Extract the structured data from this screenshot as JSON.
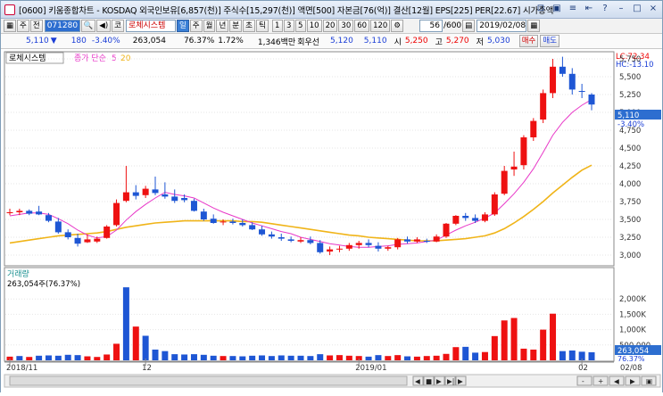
{
  "window": {
    "title": "[0600] 키움종합차트 - KOSDAQ 외국인보유[6,857(천)] 주식수[15,297(천)] 액면[500] 자본금[76(억)] 결산[12월] EPS[225] PER[22.67] 시가총액[",
    "controls": [
      "⊡",
      "▣",
      "≡",
      "⇤",
      "?",
      "–",
      "□",
      "×"
    ]
  },
  "toolbar": {
    "period_label": "주",
    "prev_label": "전",
    "code": "071280",
    "sound_label": "◀)",
    "market_label": "코",
    "stock_name": "로체시스템",
    "period_buttons": [
      "일",
      "주",
      "월",
      "년",
      "분",
      "초",
      "틱"
    ],
    "interval_buttons": [
      "1",
      "3",
      "5",
      "10",
      "20",
      "30",
      "60",
      "120"
    ],
    "count": "56",
    "count_total": "/600",
    "date": "2019/02/08"
  },
  "quote": {
    "price": "5,110",
    "arrow": "▼",
    "change": "180",
    "change_pct": "-3.40%",
    "volume": "263,054",
    "vol_ratio": "76.37%",
    "turnover": "1.72%",
    "amount": "1,346백만",
    "preferred": "회우선",
    "prev_val": "5,120",
    "cur_val": "5,110",
    "open_label": "시",
    "open": "5,250",
    "high_label": "고",
    "high": "5,270",
    "low_label": "저",
    "low": "5,030",
    "buy_label": "매수",
    "sell_label": "매도"
  },
  "chart_data": {
    "type": "candlestick",
    "legend_name": "로체시스템",
    "legend_ma_label": "종가 단순",
    "legend_ma_short": "5",
    "legend_ma_long": "20",
    "colors": {
      "up": "#ee1111",
      "down": "#1e56d4",
      "ma5": "#e838c8",
      "ma20": "#f0b418"
    },
    "ylim": [
      2900,
      5800
    ],
    "y_ticks": [
      "5,750",
      "5,500",
      "5,250",
      "5,000",
      "4,750",
      "4,500",
      "4,250",
      "4,000",
      "3,750",
      "3,500",
      "3,250",
      "3,000"
    ],
    "lc_label": "LC:72.34",
    "hc_label": "HC:-13.10",
    "last_price_label": "5,110",
    "last_change_label": "-3.40%",
    "candles": [
      [
        3600,
        3650,
        3560,
        3600
      ],
      [
        3600,
        3650,
        3560,
        3620
      ],
      [
        3620,
        3640,
        3560,
        3580
      ],
      [
        3610,
        3690,
        3560,
        3570
      ],
      [
        3560,
        3590,
        3460,
        3480
      ],
      [
        3470,
        3520,
        3300,
        3320
      ],
      [
        3320,
        3360,
        3220,
        3250
      ],
      [
        3240,
        3300,
        3120,
        3160
      ],
      [
        3180,
        3290,
        3170,
        3220
      ],
      [
        3190,
        3260,
        3170,
        3230
      ],
      [
        3240,
        3420,
        3230,
        3400
      ],
      [
        3420,
        3780,
        3400,
        3730
      ],
      [
        3760,
        4250,
        3740,
        3880
      ],
      [
        3880,
        3980,
        3780,
        3830
      ],
      [
        3840,
        3970,
        3800,
        3930
      ],
      [
        3920,
        4100,
        3840,
        3870
      ],
      [
        3850,
        4020,
        3790,
        3820
      ],
      [
        3820,
        3920,
        3730,
        3760
      ],
      [
        3800,
        3850,
        3740,
        3770
      ],
      [
        3760,
        3790,
        3610,
        3620
      ],
      [
        3610,
        3650,
        3480,
        3500
      ],
      [
        3510,
        3570,
        3440,
        3450
      ],
      [
        3460,
        3500,
        3420,
        3470
      ],
      [
        3470,
        3510,
        3430,
        3450
      ],
      [
        3450,
        3500,
        3400,
        3420
      ],
      [
        3420,
        3460,
        3350,
        3360
      ],
      [
        3360,
        3410,
        3270,
        3290
      ],
      [
        3290,
        3330,
        3230,
        3260
      ],
      [
        3250,
        3300,
        3200,
        3230
      ],
      [
        3220,
        3260,
        3180,
        3200
      ],
      [
        3190,
        3250,
        3170,
        3210
      ],
      [
        3210,
        3260,
        3150,
        3170
      ],
      [
        3170,
        3210,
        3020,
        3040
      ],
      [
        3050,
        3120,
        3000,
        3080
      ],
      [
        3080,
        3130,
        3040,
        3090
      ],
      [
        3090,
        3170,
        3060,
        3140
      ],
      [
        3140,
        3200,
        3090,
        3170
      ],
      [
        3170,
        3220,
        3110,
        3140
      ],
      [
        3130,
        3180,
        3050,
        3090
      ],
      [
        3090,
        3130,
        3060,
        3110
      ],
      [
        3110,
        3240,
        3080,
        3220
      ],
      [
        3220,
        3260,
        3160,
        3190
      ],
      [
        3190,
        3250,
        3170,
        3220
      ],
      [
        3200,
        3230,
        3170,
        3190
      ],
      [
        3190,
        3290,
        3180,
        3260
      ],
      [
        3260,
        3450,
        3240,
        3440
      ],
      [
        3440,
        3560,
        3420,
        3550
      ],
      [
        3550,
        3590,
        3480,
        3520
      ],
      [
        3520,
        3570,
        3450,
        3480
      ],
      [
        3480,
        3600,
        3460,
        3570
      ],
      [
        3570,
        3880,
        3550,
        3850
      ],
      [
        3860,
        4250,
        3840,
        4180
      ],
      [
        4200,
        4450,
        4110,
        4240
      ],
      [
        4260,
        4680,
        4200,
        4650
      ],
      [
        4650,
        4920,
        4600,
        4880
      ],
      [
        4900,
        5320,
        4850,
        5270
      ],
      [
        5270,
        5750,
        5200,
        5640
      ],
      [
        5640,
        5780,
        5500,
        5540
      ],
      [
        5540,
        5620,
        5250,
        5320
      ],
      [
        5300,
        5400,
        5200,
        5290
      ],
      [
        5250,
        5270,
        5030,
        5110
      ]
    ],
    "ma5": [
      3550,
      3570,
      3590,
      3590,
      3570,
      3510,
      3440,
      3350,
      3280,
      3240,
      3260,
      3350,
      3490,
      3610,
      3710,
      3800,
      3880,
      3850,
      3830,
      3800,
      3730,
      3660,
      3600,
      3550,
      3500,
      3450,
      3410,
      3370,
      3330,
      3300,
      3250,
      3220,
      3190,
      3160,
      3140,
      3120,
      3110,
      3110,
      3120,
      3130,
      3150,
      3160,
      3170,
      3190,
      3210,
      3280,
      3350,
      3410,
      3460,
      3520,
      3590,
      3720,
      3860,
      4020,
      4210,
      4440,
      4680,
      4860,
      5000,
      5100,
      5180
    ],
    "ma20": [
      3170,
      3190,
      3210,
      3230,
      3250,
      3270,
      3280,
      3290,
      3300,
      3310,
      3330,
      3360,
      3390,
      3410,
      3430,
      3450,
      3460,
      3470,
      3480,
      3480,
      3480,
      3480,
      3480,
      3480,
      3470,
      3470,
      3460,
      3440,
      3420,
      3400,
      3380,
      3360,
      3340,
      3320,
      3300,
      3280,
      3270,
      3250,
      3240,
      3230,
      3220,
      3210,
      3200,
      3200,
      3200,
      3210,
      3220,
      3230,
      3250,
      3270,
      3310,
      3370,
      3450,
      3540,
      3640,
      3750,
      3870,
      3980,
      4090,
      4190,
      4260
    ],
    "volume_title": "거래량",
    "volume_label": "263,054주(76.37%)",
    "volume_ylim": [
      0,
      2500000
    ],
    "volume_ticks": [
      "2,000K",
      "1,500K",
      "1,000K",
      "500,000"
    ],
    "volume_last_label": "263,054",
    "volume_pct_label": "76.37%",
    "volumes": [
      [
        120000,
        0
      ],
      [
        140000,
        1
      ],
      [
        110000,
        0
      ],
      [
        150000,
        1
      ],
      [
        160000,
        1
      ],
      [
        150000,
        1
      ],
      [
        180000,
        1
      ],
      [
        170000,
        1
      ],
      [
        130000,
        0
      ],
      [
        110000,
        0
      ],
      [
        190000,
        0
      ],
      [
        540000,
        0
      ],
      [
        2380000,
        1
      ],
      [
        1100000,
        0
      ],
      [
        800000,
        1
      ],
      [
        350000,
        1
      ],
      [
        300000,
        1
      ],
      [
        200000,
        1
      ],
      [
        190000,
        1
      ],
      [
        200000,
        1
      ],
      [
        180000,
        1
      ],
      [
        150000,
        1
      ],
      [
        140000,
        0
      ],
      [
        140000,
        1
      ],
      [
        130000,
        1
      ],
      [
        150000,
        1
      ],
      [
        160000,
        1
      ],
      [
        140000,
        1
      ],
      [
        160000,
        1
      ],
      [
        150000,
        1
      ],
      [
        150000,
        1
      ],
      [
        140000,
        1
      ],
      [
        200000,
        1
      ],
      [
        160000,
        0
      ],
      [
        170000,
        0
      ],
      [
        150000,
        0
      ],
      [
        140000,
        0
      ],
      [
        120000,
        1
      ],
      [
        170000,
        1
      ],
      [
        140000,
        0
      ],
      [
        170000,
        0
      ],
      [
        130000,
        1
      ],
      [
        120000,
        0
      ],
      [
        140000,
        0
      ],
      [
        150000,
        0
      ],
      [
        210000,
        0
      ],
      [
        430000,
        0
      ],
      [
        440000,
        1
      ],
      [
        250000,
        1
      ],
      [
        270000,
        0
      ],
      [
        790000,
        0
      ],
      [
        1300000,
        0
      ],
      [
        1380000,
        0
      ],
      [
        380000,
        0
      ],
      [
        350000,
        0
      ],
      [
        1000000,
        0
      ],
      [
        1520000,
        0
      ],
      [
        300000,
        1
      ],
      [
        320000,
        1
      ],
      [
        280000,
        1
      ],
      [
        263054,
        1
      ]
    ],
    "x_labels": [
      {
        "i": 0,
        "text": "2018/11"
      },
      {
        "i": 14,
        "text": "12"
      },
      {
        "i": 36,
        "text": "2019/01"
      },
      {
        "i": 59,
        "text": "02"
      }
    ],
    "x_last_label": "02/08"
  },
  "scrollbar": {
    "buttons": [
      "◀",
      "■",
      "▶",
      "▶|",
      "▶"
    ],
    "right_buttons": [
      "-",
      "+",
      "◀",
      "▶",
      "▣"
    ]
  }
}
